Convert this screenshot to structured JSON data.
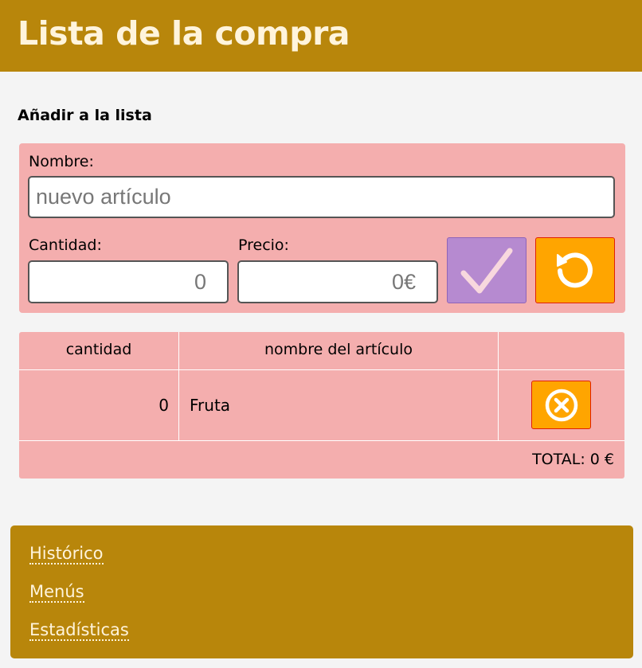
{
  "header": {
    "title": "Lista de la compra"
  },
  "form": {
    "section_title": "Añadir a la lista",
    "nombre_label": "Nombre:",
    "nombre_placeholder": "nuevo artículo",
    "cantidad_label": "Cantidad:",
    "cantidad_value": "0",
    "precio_label": "Precio:",
    "precio_value": "0€",
    "confirm_icon": "checkmark-icon",
    "reset_icon": "reset-icon"
  },
  "table": {
    "headers": [
      "cantidad",
      "nombre del artículo",
      ""
    ],
    "rows": [
      {
        "cantidad": "0",
        "nombre": "Fruta",
        "action_icon": "remove-icon"
      }
    ],
    "total": "TOTAL: 0 €"
  },
  "nav": {
    "links": [
      {
        "label": "Histórico"
      },
      {
        "label": "Menús"
      },
      {
        "label": "Estadísticas"
      }
    ]
  },
  "colors": {
    "header_bg": "#b8860b",
    "panel_bg": "#f4aeae",
    "confirm_bg": "#b68ad0",
    "action_bg": "#ffa500"
  }
}
